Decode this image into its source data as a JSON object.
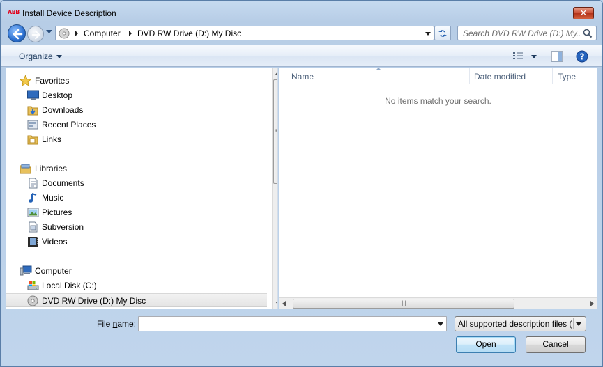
{
  "window": {
    "title": "Install Device Description",
    "app_logo_text": "ABB"
  },
  "address": {
    "crumbs": [
      "Computer",
      "DVD RW Drive (D:) My Disc"
    ],
    "search_placeholder": "Search DVD RW Drive (D:) My..."
  },
  "toolbar": {
    "organize_label": "Organize"
  },
  "nav": {
    "groups": [
      {
        "label": "Favorites",
        "icon": "star-icon",
        "items": [
          {
            "label": "Desktop",
            "icon": "desktop-icon"
          },
          {
            "label": "Downloads",
            "icon": "downloads-folder-icon"
          },
          {
            "label": "Recent Places",
            "icon": "recent-places-icon"
          },
          {
            "label": "Links",
            "icon": "links-folder-icon"
          }
        ]
      },
      {
        "label": "Libraries",
        "icon": "libraries-icon",
        "items": [
          {
            "label": "Documents",
            "icon": "documents-icon"
          },
          {
            "label": "Music",
            "icon": "music-icon"
          },
          {
            "label": "Pictures",
            "icon": "pictures-icon"
          },
          {
            "label": "Subversion",
            "icon": "subversion-icon"
          },
          {
            "label": "Videos",
            "icon": "videos-icon"
          }
        ]
      },
      {
        "label": "Computer",
        "icon": "computer-icon",
        "items": [
          {
            "label": "Local Disk (C:)",
            "icon": "local-disk-icon"
          },
          {
            "label": "DVD RW Drive (D:) My Disc",
            "icon": "dvd-drive-icon",
            "selected": true
          }
        ]
      }
    ]
  },
  "file_list": {
    "columns": [
      "Name",
      "Date modified",
      "Type"
    ],
    "empty_message": "No items match your search."
  },
  "footer": {
    "filename_label_pre": "File ",
    "filename_label_accel": "n",
    "filename_label_post": "ame:",
    "filename_value": "",
    "filetype_selected": "All supported description files (",
    "open_label": "Open",
    "cancel_label": "Cancel"
  }
}
